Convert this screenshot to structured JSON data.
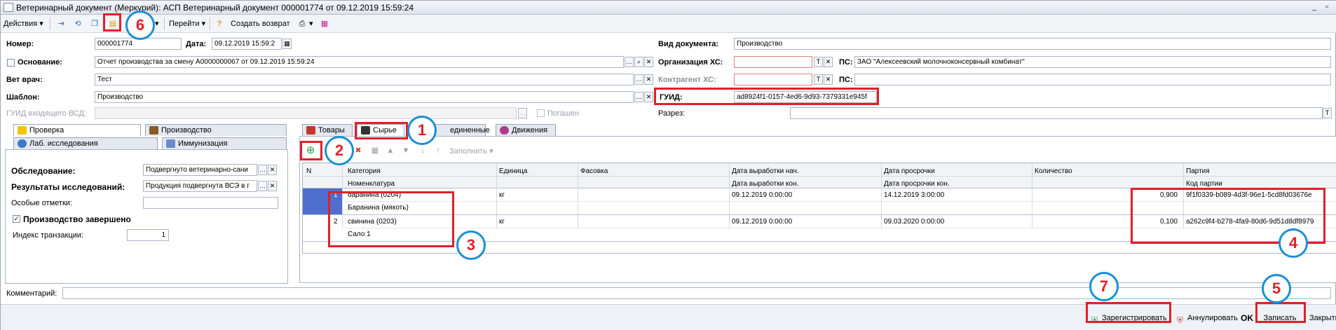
{
  "window": {
    "title": "Ветеринарный документ (Меркурий): АСП Ветеринарный документ 000001774 от 09.12.2019 15:59:24"
  },
  "toolbar": {
    "actions": "Действия",
    "goto": "Перейти",
    "create_return": "Создать возврат"
  },
  "form": {
    "number_label": "Номер:",
    "number_value": "000001774",
    "date_label": "Дата:",
    "date_value": "09.12.2019 15:59:2",
    "basis_label": "Основание:",
    "basis_value": "Отчет производства за смену А0000000067 от 09.12.2019 15:59:24",
    "vet_label": "Вет врач:",
    "vet_value": "Тест",
    "template_label": "Шаблон:",
    "template_value": "Производство",
    "incoming_guid_label": "ГУИД входящего ВСД:",
    "canceled_label": "Погашен",
    "doc_type_label": "Вид документа:",
    "doc_type_value": "Производство",
    "org_label": "Организация ХС:",
    "ps_label": "ПС:",
    "ps_value": "ЗАО \"Алексеевский молочноконсервный комбинат\"",
    "contractor_label": "Контрагент ХС:",
    "ps2_label": "ПС:",
    "guid_label": "ГУИД:",
    "guid_value": "ad8924f1-0157-4ed6-9d93-7379331e945f",
    "permit_label": "Разрез:"
  },
  "left_tabs": {
    "check": "Проверка",
    "production": "Производство",
    "lab": "Лаб. исследования",
    "immunization": "Иммунизация"
  },
  "check_panel": {
    "inspection_label": "Обследование:",
    "inspection_value": "Подвергнуто ветеринарно-сани",
    "results_label": "Результаты исследований:",
    "results_value": "Продукция подвергнута ВСЭ в г",
    "notes_label": "Особые отметки:",
    "production_done_label": "Производство завершено",
    "tx_index_label": "Индекс транзакции:",
    "tx_index_value": "1"
  },
  "right_tabs": {
    "goods": "Товары",
    "raw": "Сырье",
    "joined": "единенные",
    "movements": "Движения"
  },
  "grid_toolbar": {
    "fill": "Заполнить"
  },
  "grid": {
    "headers": {
      "n": "N",
      "category": "Категория",
      "nomenclature": "Номенклатура",
      "unit": "Единица",
      "packing": "Фасовка",
      "prod_start": "Дата выработки нач.",
      "prod_end": "Дата выработки кон.",
      "expiry": "Дата просрочки",
      "expiry_end": "Дата просрочки кон.",
      "qty": "Количество",
      "batch": "Партия",
      "batch_code": "Код партии"
    },
    "rows": [
      {
        "n": "1",
        "category": "баранина (0204)",
        "nomenclature": "Баранина (мякоть)",
        "unit": "кг",
        "prod_start": "09.12.2019 0:00:00",
        "expiry": "14.12.2019 3:00:00",
        "qty": "0,900",
        "batch": "9f1f0339-b089-4d3f-96e1-5cd8fd03676e"
      },
      {
        "n": "2",
        "category": "свинина (0203)",
        "nomenclature": "Сало 1",
        "unit": "кг",
        "prod_start": "09.12.2019 0:00:00",
        "expiry": "09.03.2020 0:00:00",
        "qty": "0,100",
        "batch": "a262c9f4-b278-4fa9-80d6-9d51d8df8979"
      }
    ]
  },
  "comment_label": "Комментарий:",
  "footer": {
    "register": "Зарегистрировать",
    "cancel": "Аннулировать",
    "ok": "OK",
    "save": "Записать",
    "close": "Закрыть"
  },
  "callouts": [
    "1",
    "2",
    "3",
    "4",
    "5",
    "6",
    "7"
  ],
  "colors": {
    "highlight": "#e0202a",
    "callout_border": "#1b8fd6",
    "selected_row": "#4f6fcf"
  }
}
